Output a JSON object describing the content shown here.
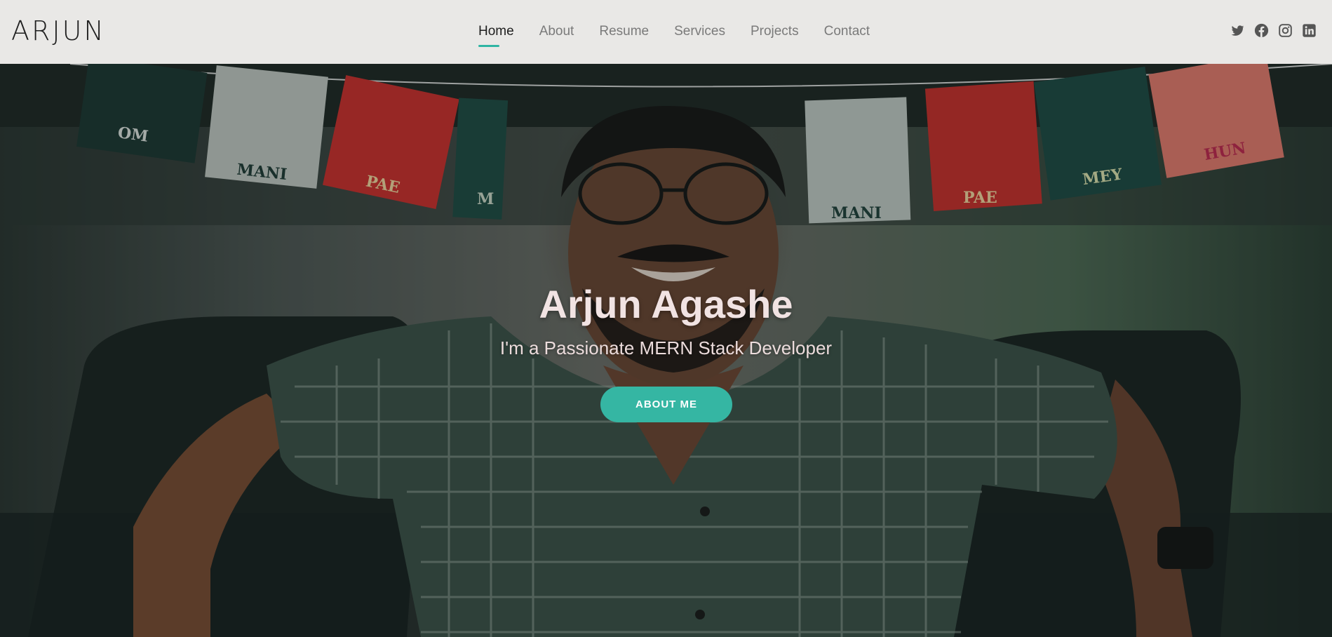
{
  "brand": "ARJUN",
  "nav": {
    "items": [
      {
        "label": "Home",
        "active": true
      },
      {
        "label": "About",
        "active": false
      },
      {
        "label": "Resume",
        "active": false
      },
      {
        "label": "Services",
        "active": false
      },
      {
        "label": "Projects",
        "active": false
      },
      {
        "label": "Contact",
        "active": false
      }
    ]
  },
  "social": [
    "twitter-icon",
    "facebook-icon",
    "instagram-icon",
    "linkedin-icon"
  ],
  "hero": {
    "title": "Arjun Agashe",
    "subtitle": "I'm a Passionate MERN Stack Developer",
    "button": "ABOUT ME"
  },
  "flags": {
    "left": [
      "OM",
      "MANI",
      "PAE",
      "M"
    ],
    "right": [
      "MANI",
      "PAE",
      "MEY",
      "HUN"
    ]
  },
  "colors": {
    "accent": "#35b6a3",
    "header_bg": "#e9e8e6",
    "nav_active": "#1e1e1e",
    "nav_inactive": "#7a7a7a",
    "flag_red": "#c9302c",
    "flag_green": "#1d4a45",
    "flag_white": "#c9cfcc",
    "flag_pink": "#e8716a"
  }
}
